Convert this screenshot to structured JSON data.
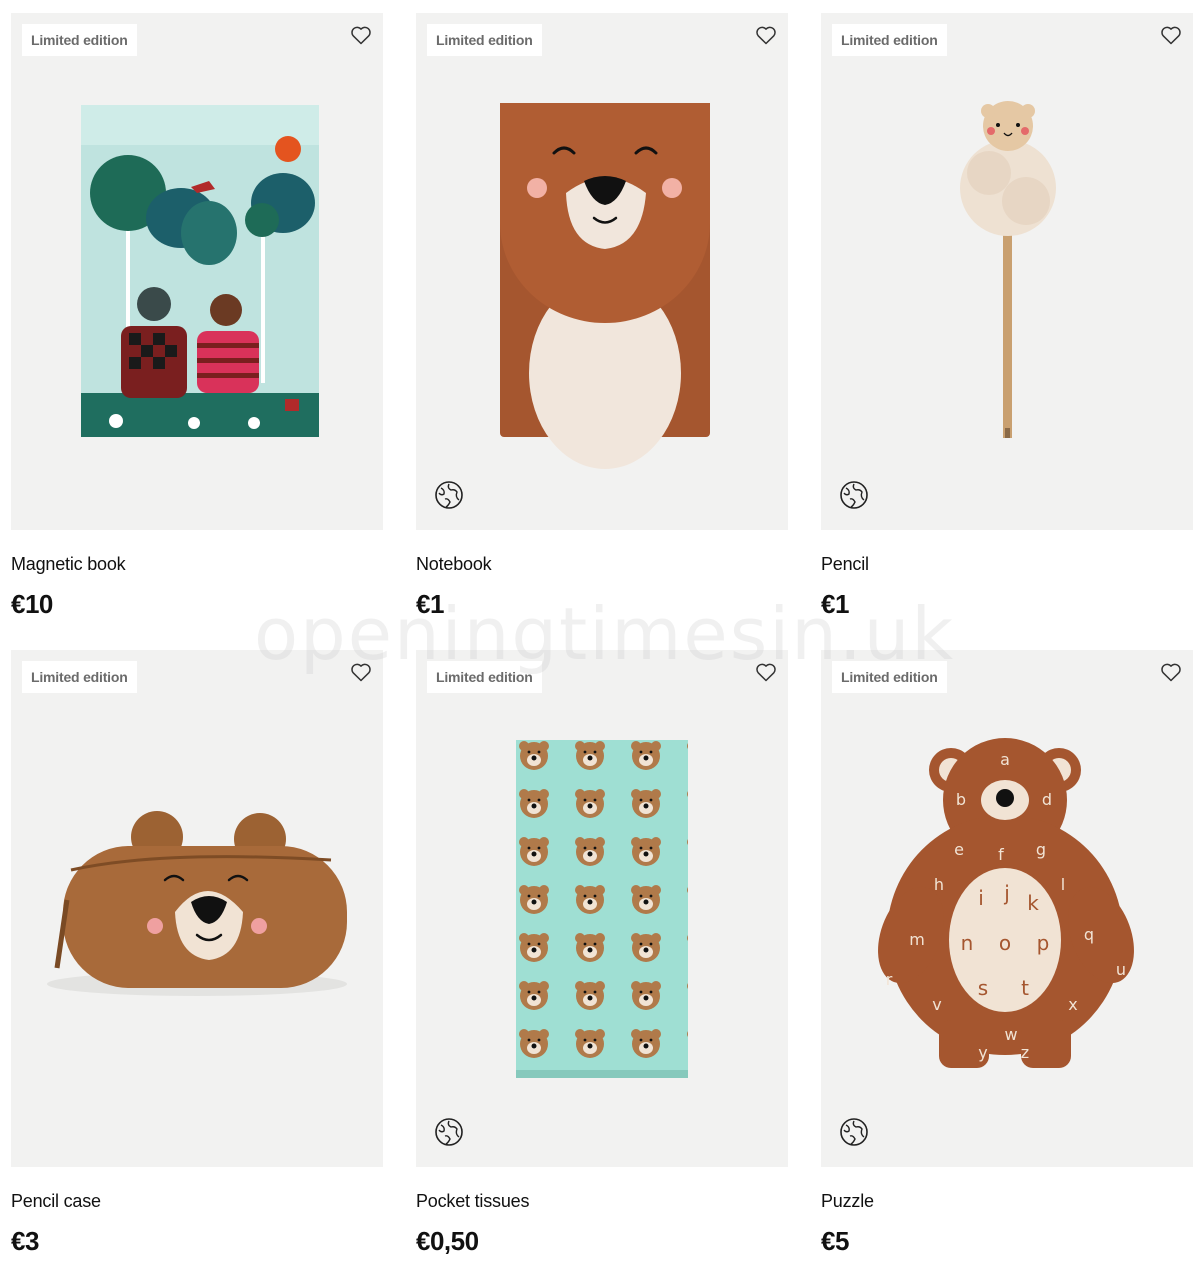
{
  "watermark": "openingtimesin.uk",
  "products": [
    {
      "name": "Magnetic book",
      "price": "€10",
      "badge": "Limited edition",
      "globe": false
    },
    {
      "name": "Notebook",
      "price": "€1",
      "badge": "Limited edition",
      "globe": true
    },
    {
      "name": "Pencil",
      "price": "€1",
      "badge": "Limited edition",
      "globe": true
    },
    {
      "name": "Pencil case",
      "price": "€3",
      "badge": "Limited edition",
      "globe": false
    },
    {
      "name": "Pocket tissues",
      "price": "€0,50",
      "badge": "Limited edition",
      "globe": true
    },
    {
      "name": "Puzzle",
      "price": "€5",
      "badge": "Limited edition",
      "globe": true
    }
  ],
  "colors": {
    "card_background": "#f2f2f1",
    "badge_text": "#6b6b6b",
    "bear_brown": "#a5562f",
    "tissue_mint": "#9fdfd3"
  }
}
